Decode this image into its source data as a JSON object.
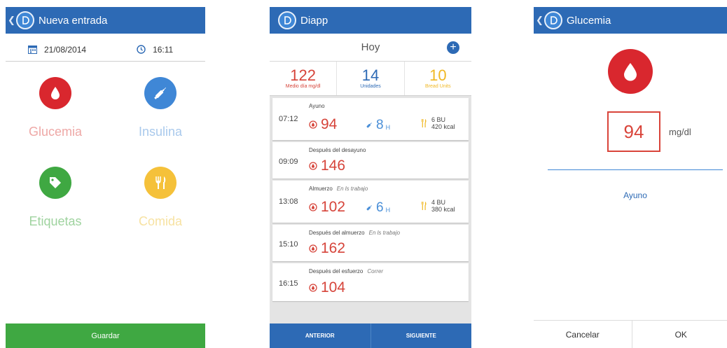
{
  "colors": {
    "brand_blue": "#2d6ab5",
    "glucose_red": "#d9272e",
    "insulin_blue": "#4a8fd8",
    "tag_green": "#3fa842",
    "food_yellow": "#f5c13a"
  },
  "screen1": {
    "title": "Nueva entrada",
    "date": "21/08/2014",
    "time": "16:11",
    "categories": [
      {
        "label": "Glucemia",
        "icon": "blood-drop-icon"
      },
      {
        "label": "Insulina",
        "icon": "syringe-icon"
      },
      {
        "label": "Etiquetas",
        "icon": "tag-icon"
      },
      {
        "label": "Comida",
        "icon": "fork-knife-icon"
      }
    ],
    "save_label": "Guardar"
  },
  "screen2": {
    "title": "Diapp",
    "day_label": "Hoy",
    "stats": [
      {
        "value": "122",
        "label": "Medio día mg/dl"
      },
      {
        "value": "14",
        "label": "Unidades"
      },
      {
        "value": "10",
        "label": "Bread Units"
      }
    ],
    "entries": [
      {
        "time": "07:12",
        "name": "Ayuno",
        "tag": "",
        "glucose": "94",
        "insulin": "8",
        "insulin_unit": "H",
        "food_bu": "6 BU",
        "food_kcal": "420 kcal"
      },
      {
        "time": "09:09",
        "name": "Después del desayuno",
        "tag": "",
        "glucose": "146"
      },
      {
        "time": "13:08",
        "name": "Almuerzo",
        "tag": "En ls trabajo",
        "glucose": "102",
        "insulin": "6",
        "insulin_unit": "H",
        "food_bu": "4 BU",
        "food_kcal": "380 kcal"
      },
      {
        "time": "15:10",
        "name": "Después del almuerzo",
        "tag": "En ls trabajo",
        "glucose": "162"
      },
      {
        "time": "16:15",
        "name": "Después del esfuerzo",
        "tag": "Correr",
        "glucose": "104"
      }
    ],
    "prev_label": "ANTERIOR",
    "next_label": "SIGUIENTE"
  },
  "screen3": {
    "title": "Glucemia",
    "value": "94",
    "unit": "mg/dl",
    "tag": "Ayuno",
    "cancel_label": "Cancelar",
    "ok_label": "OK"
  }
}
